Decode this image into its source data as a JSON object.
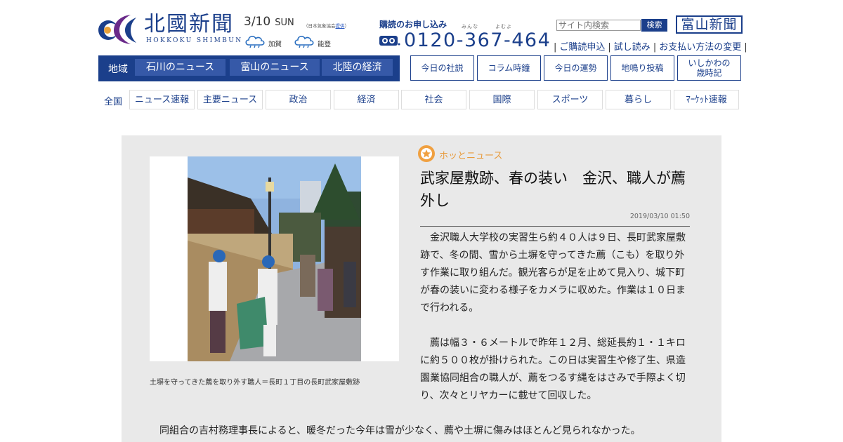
{
  "header": {
    "logo_text": "北國新聞",
    "logo_sub": "HOKKOKU SHIMBUN",
    "date": "3/10",
    "weekday": "SUN",
    "weather_source_prefix": "（日本気象協会",
    "weather_source_link": "提供",
    "weather_source_suffix": "）",
    "weather": [
      {
        "region": "加賀",
        "icon": "rain-cloud-icon"
      },
      {
        "region": "能登",
        "icon": "rain-cloud-icon"
      }
    ],
    "subscribe_label": "購読のお申し込み",
    "phone_ruby": "みんな　　　よむよ",
    "phone_icon": "freedial-icon",
    "phone": "0120-367-464",
    "search_placeholder": "サイト内検索",
    "search_button": "検索",
    "toyama_link": "富山新聞",
    "util_links": [
      "ご購読申込",
      "試し読み",
      "お支払い方法の変更"
    ]
  },
  "region_nav": {
    "label": "地域",
    "tabs": [
      "石川のニュース",
      "富山のニュース",
      "北陸の経済"
    ]
  },
  "box_links": [
    "今日の社説",
    "コラム時鐘",
    "今日の運勢",
    "地鳴り投稿",
    "いしかわの\n歳時記"
  ],
  "category_nav": {
    "all": "全国",
    "items": [
      "ニュース速報",
      "主要ニュース",
      "政治",
      "経済",
      "社会",
      "国際",
      "スポーツ",
      "暮らし",
      "ﾏｰｹｯﾄ速報"
    ]
  },
  "article": {
    "section_label": "ホッとニュース",
    "section_icon": "star-badge-icon",
    "headline": "武家屋敷跡、春の装い　金沢、職人が薦外し",
    "timestamp": "2019/03/10 01:50",
    "photo_caption": "土塀を守ってきた薦を取り外す職人＝長町１丁目の長町武家屋敷跡",
    "paragraphs": [
      "金沢職人大学校の実習生ら約４０人は９日、長町武家屋敷跡で、冬の間、雪から土塀を守ってきた薦（こも）を取り外す作業に取り組んだ。観光客らが足を止めて見入り、城下町が春の装いに変わる様子をカメラに収めた。作業は１０日まで行われる。",
      "薦は幅３・６メートルで昨年１２月、総延長約１・１キロに約５００枚が掛けられた。この日は実習生や修了生、県造園業協同組合の職人が、薦をつるす縄をはさみで手際よく切り、次々とリヤカーに載せて回収した。"
    ],
    "last_paragraph": "同組合の吉村務理事長によると、暖冬だった今年は雪が少なく、薦や土塀に傷みはほとんど見られなかった。"
  },
  "colors": {
    "brand_navy": "#1b3f8b",
    "tab_blue": "#3659a8",
    "accent_orange": "#e89a3a",
    "article_bg": "#e9e9e9"
  }
}
